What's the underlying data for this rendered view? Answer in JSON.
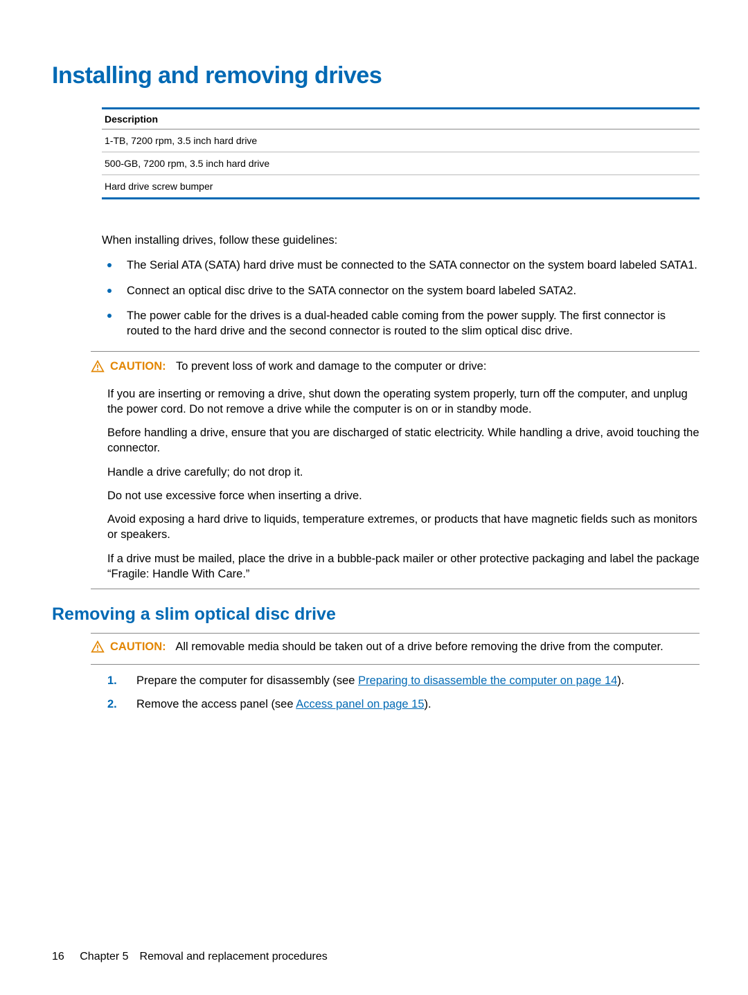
{
  "heading1": "Installing and removing drives",
  "table": {
    "header": "Description",
    "rows": [
      "1-TB, 7200 rpm, 3.5 inch hard drive",
      "500-GB, 7200 rpm, 3.5 inch hard drive",
      "Hard drive screw bumper"
    ]
  },
  "intro": "When installing drives, follow these guidelines:",
  "bullets": [
    "The Serial ATA (SATA) hard drive must be connected to the SATA connector on the system board labeled SATA1.",
    "Connect an optical disc drive to the SATA connector on the system board labeled SATA2.",
    "The power cable for the drives is a dual-headed cable coming from the power supply. The first connector is routed to the hard drive and the second connector is routed to the slim optical disc drive."
  ],
  "caution1": {
    "label": "CAUTION:",
    "lead": "To prevent loss of work and damage to the computer or drive:",
    "paras": [
      "If you are inserting or removing a drive, shut down the operating system properly, turn off the computer, and unplug the power cord. Do not remove a drive while the computer is on or in standby mode.",
      "Before handling a drive, ensure that you are discharged of static electricity. While handling a drive, avoid touching the connector.",
      "Handle a drive carefully; do not drop it.",
      "Do not use excessive force when inserting a drive.",
      "Avoid exposing a hard drive to liquids, temperature extremes, or products that have magnetic fields such as monitors or speakers.",
      "If a drive must be mailed, place the drive in a bubble-pack mailer or other protective packaging and label the package “Fragile: Handle With Care.”"
    ]
  },
  "heading2": "Removing a slim optical disc drive",
  "caution2": {
    "label": "CAUTION:",
    "text": "All removable media should be taken out of a drive before removing the drive from the computer."
  },
  "steps": [
    {
      "num": "1.",
      "pre": "Prepare the computer for disassembly (see ",
      "link": "Preparing to disassemble the computer on page 14",
      "post": ")."
    },
    {
      "num": "2.",
      "pre": "Remove the access panel (see ",
      "link": "Access panel on page 15",
      "post": ")."
    }
  ],
  "footer": {
    "page": "16",
    "chapter": "Chapter 5 Removal and replacement procedures"
  }
}
